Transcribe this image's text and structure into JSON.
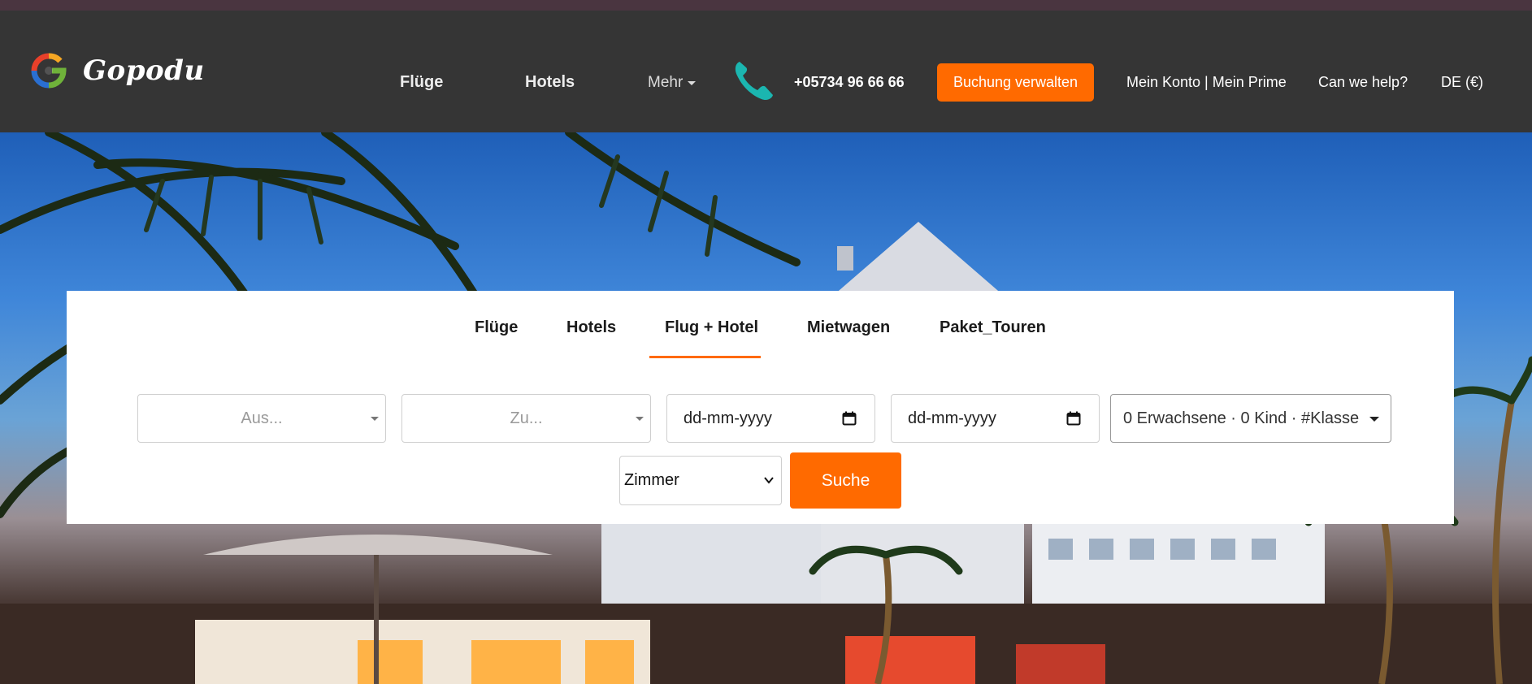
{
  "colors": {
    "accent": "#ff6a00",
    "header_bg": "#353535",
    "topstrip": "#4a3540",
    "phone_icon": "#1bb6b0"
  },
  "brand": {
    "name": "Gopodu",
    "logo_icon": "gopodu-logo-icon"
  },
  "nav": {
    "flights": "Flüge",
    "hotels": "Hotels",
    "more": "Mehr",
    "phone_icon": "phone-icon",
    "phone": "+05734 96 66 66",
    "manage_booking": "Buchung verwalten",
    "account": "Mein Konto | Mein Prime",
    "help": "Can we help?",
    "locale": "DE (€)"
  },
  "search": {
    "tabs": [
      {
        "label": "Flüge",
        "active": false
      },
      {
        "label": "Hotels",
        "active": false
      },
      {
        "label": "Flug + Hotel",
        "active": true
      },
      {
        "label": "Mietwagen",
        "active": false
      },
      {
        "label": "Paket_Touren",
        "active": false
      }
    ],
    "from_placeholder": "Aus...",
    "to_placeholder": "Zu...",
    "depart_date": "dd-mm-yyyy",
    "return_date": "dd-mm-yyyy",
    "passengers": "0 Erwachsene · 0 Kind · #Klasse",
    "rooms": "Zimmer",
    "submit": "Suche"
  }
}
